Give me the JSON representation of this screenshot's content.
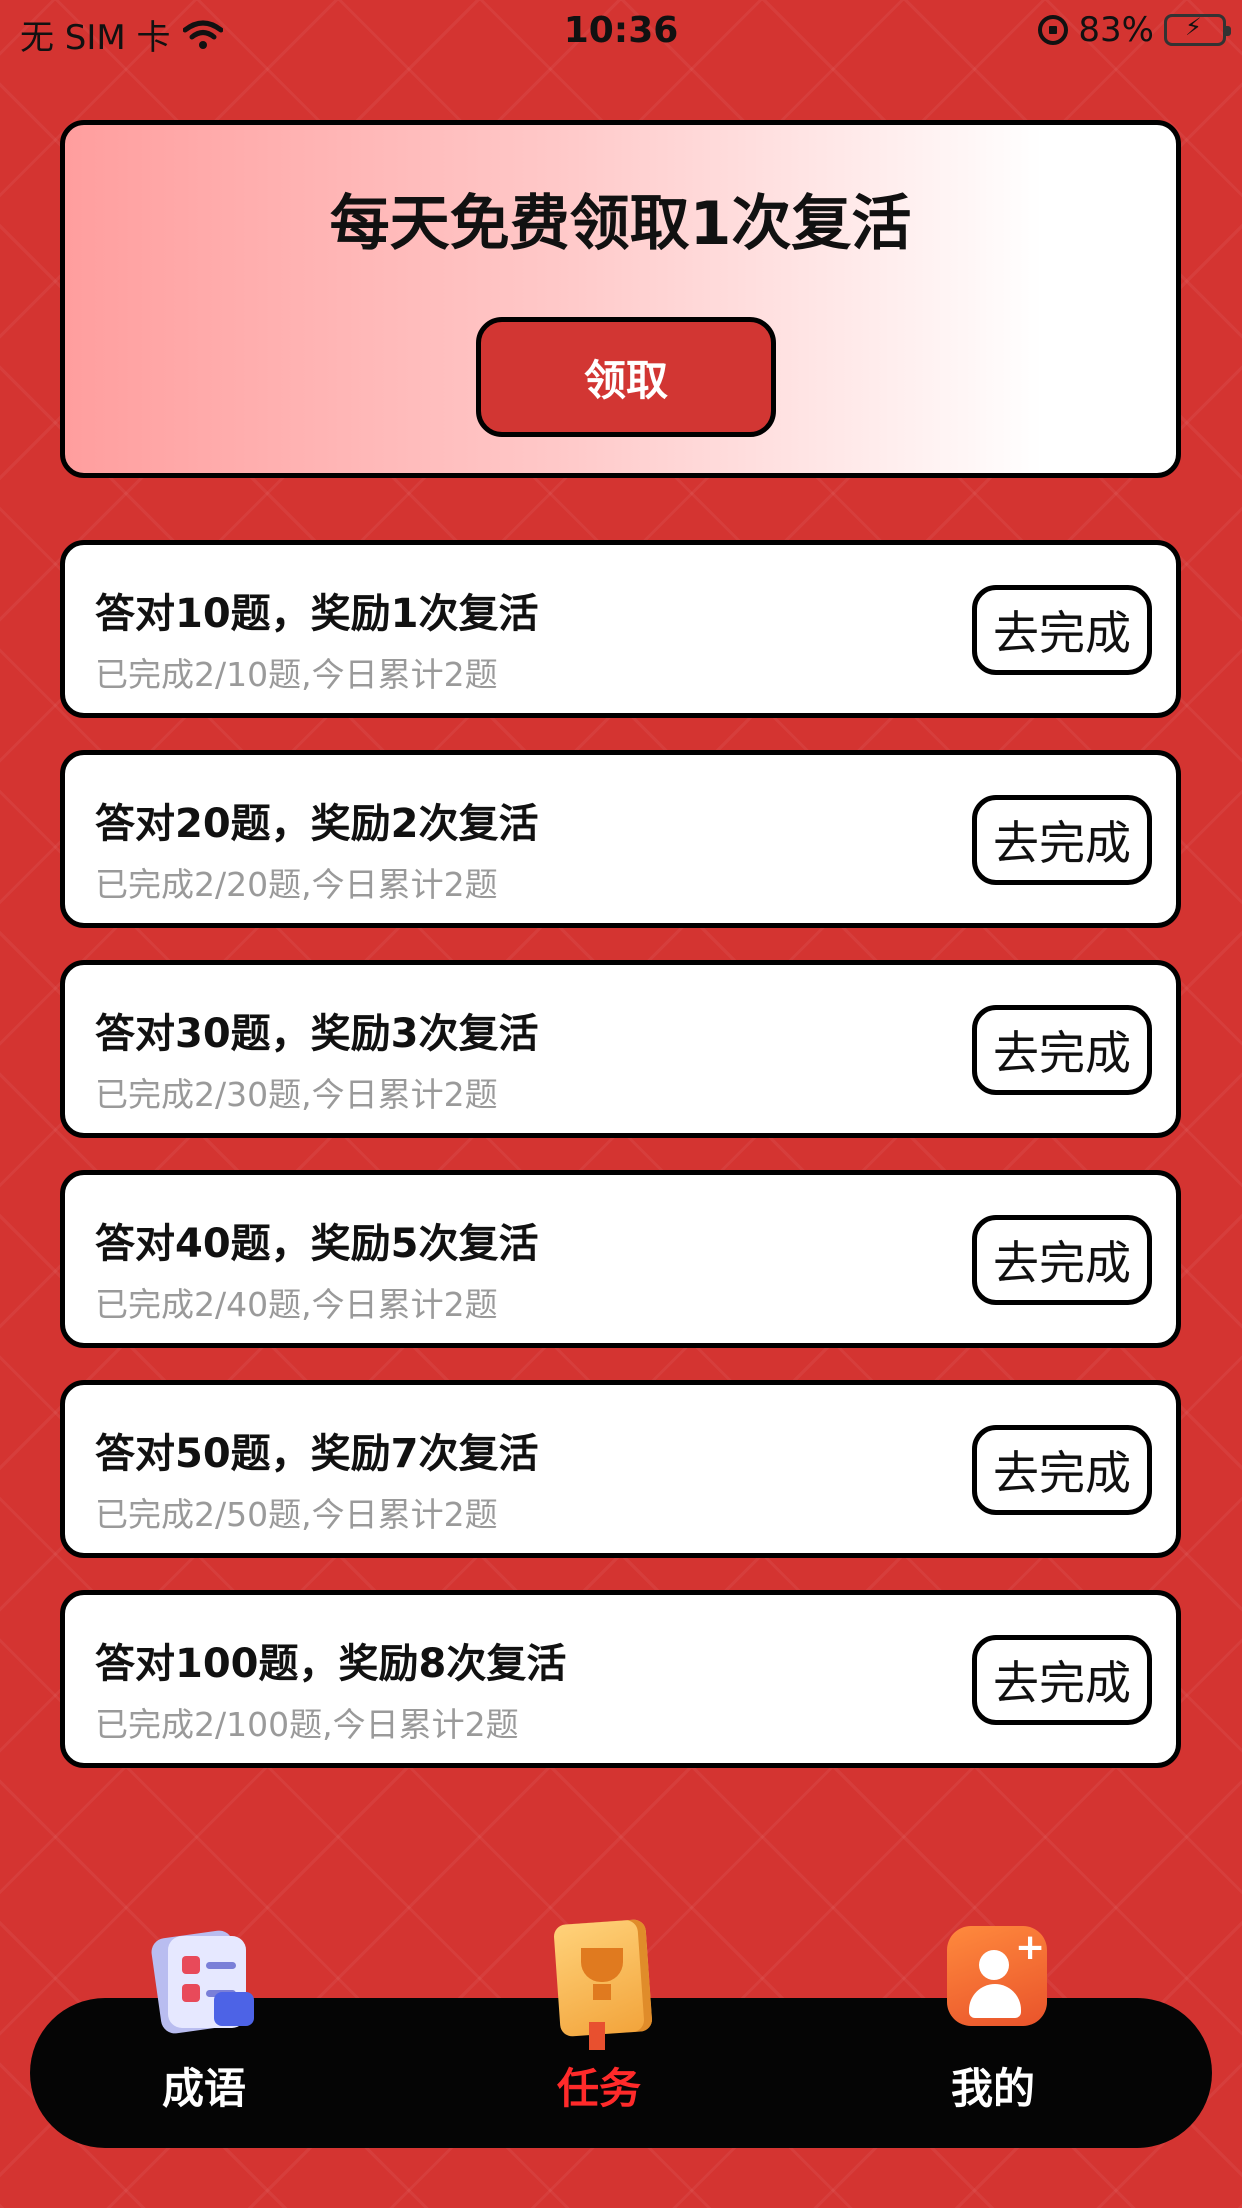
{
  "status_bar": {
    "carrier": "无 SIM 卡",
    "time": "10:36",
    "battery_percent": "83%",
    "battery_level": 0.83
  },
  "daily_card": {
    "title": "每天免费领取1次复活",
    "claim_label": "领取"
  },
  "tasks": [
    {
      "title": "答对10题，奖励1次复活",
      "progress": "已完成2/10题,今日累计2题",
      "button": "去完成"
    },
    {
      "title": "答对20题，奖励2次复活",
      "progress": "已完成2/20题,今日累计2题",
      "button": "去完成"
    },
    {
      "title": "答对30题，奖励3次复活",
      "progress": "已完成2/30题,今日累计2题",
      "button": "去完成"
    },
    {
      "title": "答对40题，奖励5次复活",
      "progress": "已完成2/40题,今日累计2题",
      "button": "去完成"
    },
    {
      "title": "答对50题，奖励7次复活",
      "progress": "已完成2/50题,今日累计2题",
      "button": "去完成"
    },
    {
      "title": "答对100题，奖励8次复活",
      "progress": "已完成2/100题,今日累计2题",
      "button": "去完成"
    }
  ],
  "bottom_nav": {
    "items": [
      {
        "label": "成语",
        "icon": "idiom-icon",
        "active": false
      },
      {
        "label": "任务",
        "icon": "task-icon",
        "active": true
      },
      {
        "label": "我的",
        "icon": "profile-icon",
        "active": false
      }
    ],
    "active_color": "#ff2a2a"
  },
  "colors": {
    "background": "#d43431",
    "button_red": "#d23633"
  }
}
